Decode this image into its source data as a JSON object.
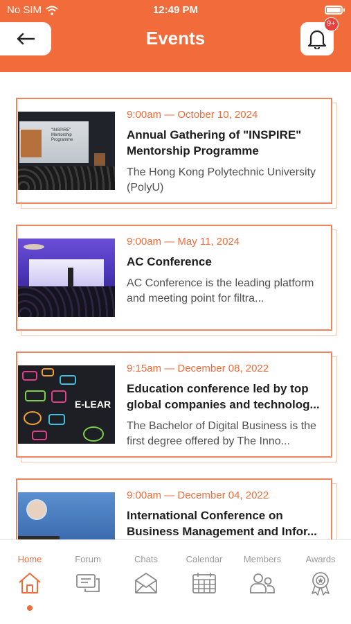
{
  "status_bar": {
    "carrier": "No SIM",
    "time": "12:49 PM"
  },
  "header": {
    "title": "Events",
    "notification_badge": "9+"
  },
  "events": [
    {
      "date": "9:00am — October 10, 2024",
      "title": "Annual Gathering of \"INSPIRE\" Mentorship Programme",
      "description": "The Hong Kong Polytechnic University (PolyU)",
      "thumb_text": "\"INSPIRE\" Mentorship Programme"
    },
    {
      "date": "9:00am — May 11, 2024",
      "title": "AC Conference",
      "description": "AC Conference is the leading platform and meeting point for filtra..."
    },
    {
      "date": "9:15am — December 08, 2022",
      "title": "Education conference led by top global companies and technolog...",
      "description": "The Bachelor of Digital Business is the first degree offered by The Inno...",
      "thumb_text": "E-LEAR"
    },
    {
      "date": "9:00am — December 04, 2022",
      "title": "International Conference on Business Management and Infor...",
      "description": ""
    }
  ],
  "tabs": [
    {
      "label": "Home",
      "icon": "home-icon",
      "active": true
    },
    {
      "label": "Forum",
      "icon": "forum-icon",
      "active": false
    },
    {
      "label": "Chats",
      "icon": "chats-icon",
      "active": false
    },
    {
      "label": "Calendar",
      "icon": "calendar-icon",
      "active": false
    },
    {
      "label": "Members",
      "icon": "members-icon",
      "active": false
    },
    {
      "label": "Awards",
      "icon": "awards-icon",
      "active": false
    }
  ],
  "colors": {
    "accent": "#f26b3a",
    "badge": "#e8413e",
    "inactive_tab": "#9a9a9a"
  }
}
